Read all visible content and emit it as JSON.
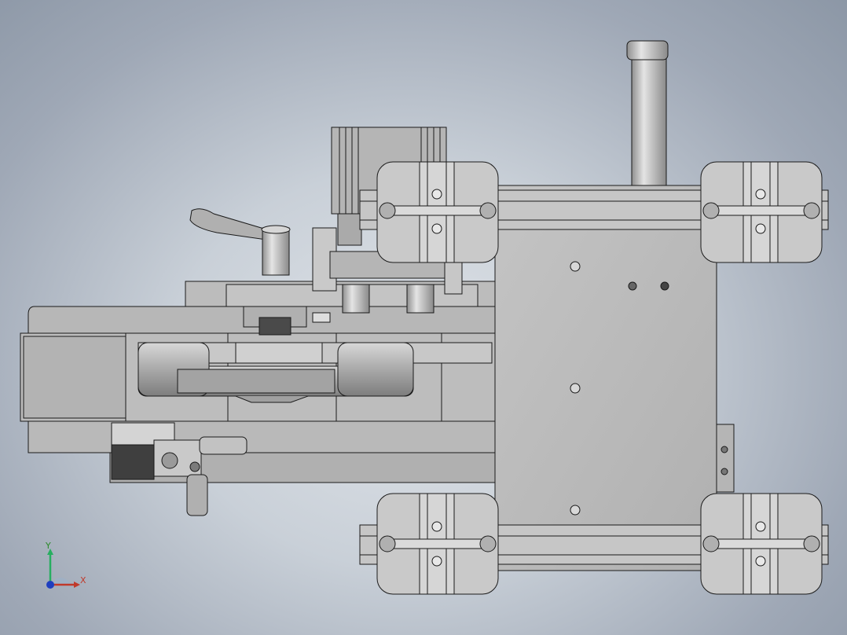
{
  "viewport": {
    "background_top": "#8c97a6",
    "background_center": "#dfe3e8",
    "model_face": "#bcbcbc",
    "model_shadow": "#8e8e8e",
    "edge": "#1a1a1a"
  },
  "triad": {
    "x_label": "X",
    "y_label": "Y",
    "x_color": "#c0392b",
    "y_color": "#27ae60",
    "z_color": "#1f3fbf"
  }
}
